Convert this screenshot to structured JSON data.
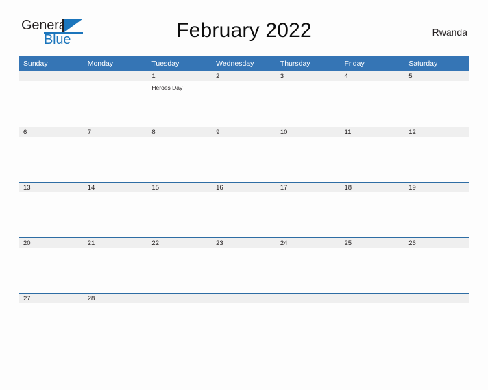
{
  "logo": {
    "word1": "General",
    "word2": "Blue",
    "flag_icon": "flag-triangle-icon",
    "accent_color": "#1b75bc"
  },
  "header": {
    "title": "February 2022",
    "country": "Rwanda"
  },
  "theme": {
    "header_blue": "#3575b5",
    "band_gray": "#efefef",
    "row_rule": "#2e6da4",
    "page_background": "#fdfdfd",
    "text": "#231f20"
  },
  "calendar": {
    "weekday_headers": [
      "Sunday",
      "Monday",
      "Tuesday",
      "Wednesday",
      "Thursday",
      "Friday",
      "Saturday"
    ],
    "weeks": [
      [
        {
          "day": "",
          "events": []
        },
        {
          "day": "",
          "events": []
        },
        {
          "day": "1",
          "events": [
            "Heroes Day"
          ]
        },
        {
          "day": "2",
          "events": []
        },
        {
          "day": "3",
          "events": []
        },
        {
          "day": "4",
          "events": []
        },
        {
          "day": "5",
          "events": []
        }
      ],
      [
        {
          "day": "6",
          "events": []
        },
        {
          "day": "7",
          "events": []
        },
        {
          "day": "8",
          "events": []
        },
        {
          "day": "9",
          "events": []
        },
        {
          "day": "10",
          "events": []
        },
        {
          "day": "11",
          "events": []
        },
        {
          "day": "12",
          "events": []
        }
      ],
      [
        {
          "day": "13",
          "events": []
        },
        {
          "day": "14",
          "events": []
        },
        {
          "day": "15",
          "events": []
        },
        {
          "day": "16",
          "events": []
        },
        {
          "day": "17",
          "events": []
        },
        {
          "day": "18",
          "events": []
        },
        {
          "day": "19",
          "events": []
        }
      ],
      [
        {
          "day": "20",
          "events": []
        },
        {
          "day": "21",
          "events": []
        },
        {
          "day": "22",
          "events": []
        },
        {
          "day": "23",
          "events": []
        },
        {
          "day": "24",
          "events": []
        },
        {
          "day": "25",
          "events": []
        },
        {
          "day": "26",
          "events": []
        }
      ],
      [
        {
          "day": "27",
          "events": []
        },
        {
          "day": "28",
          "events": []
        },
        {
          "day": "",
          "events": []
        },
        {
          "day": "",
          "events": []
        },
        {
          "day": "",
          "events": []
        },
        {
          "day": "",
          "events": []
        },
        {
          "day": "",
          "events": []
        }
      ]
    ]
  }
}
